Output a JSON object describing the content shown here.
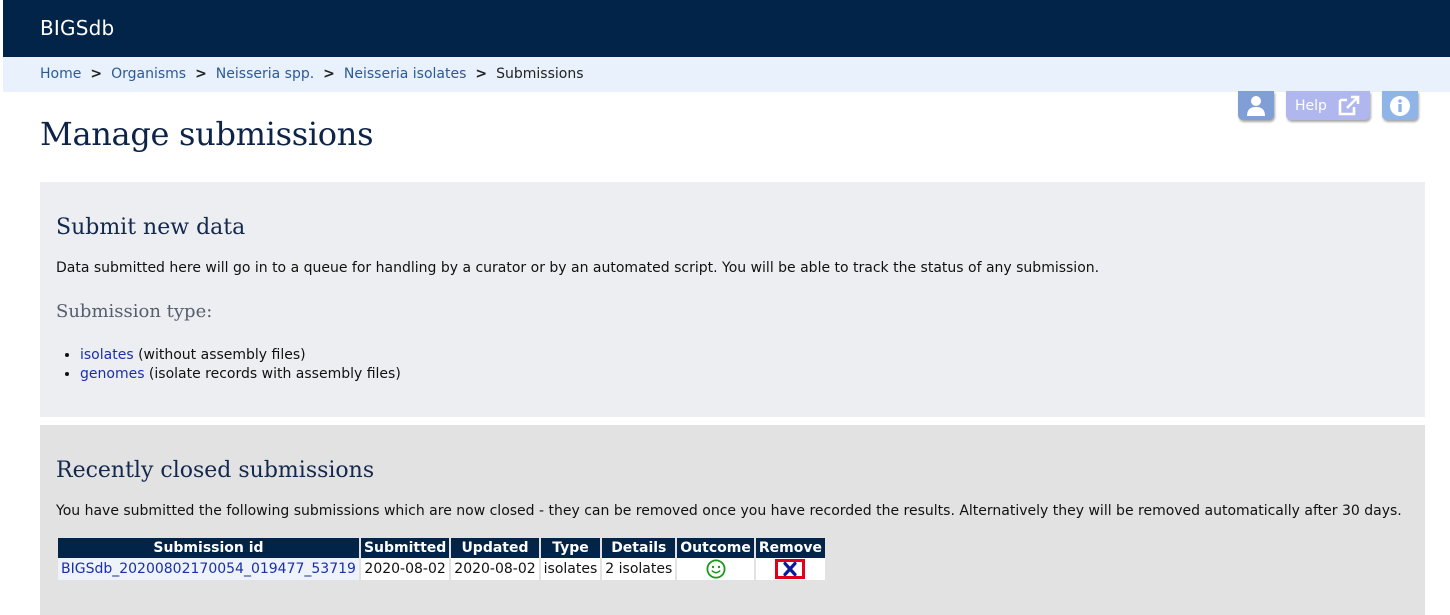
{
  "app": {
    "title": "BIGSdb"
  },
  "breadcrumb": {
    "items": [
      "Home",
      "Organisms",
      "Neisseria spp.",
      "Neisseria isolates"
    ],
    "current": "Submissions",
    "separator": ">"
  },
  "toolbar": {
    "help_label": "Help"
  },
  "page": {
    "title": "Manage submissions"
  },
  "submit_section": {
    "title": "Submit new data",
    "description": "Data submitted here will go in to a queue for handling by a curator or by an automated script. You will be able to track the status of any submission.",
    "type_heading": "Submission type:",
    "types": [
      {
        "link": "isolates",
        "note": " (without assembly files)"
      },
      {
        "link": "genomes",
        "note": " (isolate records with assembly files)"
      }
    ]
  },
  "closed_section": {
    "title": "Recently closed submissions",
    "description": "You have submitted the following submissions which are now closed - they can be removed once you have recorded the results. Alternatively they will be removed automatically after 30 days.",
    "columns": [
      "Submission id",
      "Submitted",
      "Updated",
      "Type",
      "Details",
      "Outcome",
      "Remove"
    ],
    "rows": [
      {
        "id": "BIGSdb_20200802170054_019477_53719",
        "submitted": "2020-08-02",
        "updated": "2020-08-02",
        "type": "isolates",
        "details": "2 isolates",
        "outcome": "smiley-icon",
        "remove": "remove-icon"
      }
    ]
  },
  "colors": {
    "header": "#022448",
    "breadcrumb_bg": "#e9f1fc",
    "link": "#2b5a99",
    "outcome_good": "#1a9a1a",
    "remove_highlight": "#e0001b",
    "remove_icon": "#0a1a9a"
  }
}
